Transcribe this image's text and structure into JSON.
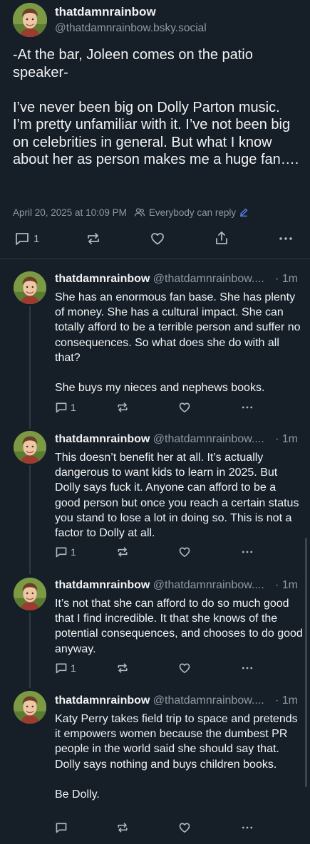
{
  "main_post": {
    "author_name": "thatdamnrainbow",
    "author_handle": "@thatdamnrainbow.bsky.social",
    "text": "-At the bar, Joleen comes on the patio speaker-\n\nI’ve never been big on Dolly Parton music. I’m pretty unfamiliar with it. I’ve not been big on celebrities in general. But what I know about her as person makes me a huge fan….",
    "timestamp": "April 20, 2025 at 10:09 PM",
    "reply_setting": "Everybody can reply",
    "reply_count": "1",
    "icons": [
      "reply-icon",
      "repost-icon",
      "like-icon",
      "share-icon",
      "more-icon",
      "people-icon",
      "pencil-icon"
    ]
  },
  "replies": [
    {
      "author_name": "thatdamnrainbow",
      "author_handle": "@thatdamnrainbow....",
      "time": "· 1m",
      "text": "She has an enormous fan base. She has plenty of money. She has a cultural impact. She can totally afford to be a terrible person and suffer no consequences. So what does she do with all that?\n\nShe buys my nieces and nephews books.",
      "reply_count": "1"
    },
    {
      "author_name": "thatdamnrainbow",
      "author_handle": "@thatdamnrainbow....",
      "time": "· 1m",
      "text": "This doesn’t benefit her at all. It’s actually dangerous to want kids to learn in 2025. But Dolly says fuck it. Anyone can afford to be a good person but once you reach a certain status you stand to lose a lot in doing so. This is not a factor to Dolly at all.",
      "reply_count": "1"
    },
    {
      "author_name": "thatdamnrainbow",
      "author_handle": "@thatdamnrainbow....",
      "time": "· 1m",
      "text": "It’s not that she can afford to do so much good that I find incredible. It that she knows of the potential consequences, and chooses to do good anyway.",
      "reply_count": "1"
    },
    {
      "author_name": "thatdamnrainbow",
      "author_handle": "@thatdamnrainbow....",
      "time": "· 1m",
      "text": "Katy Perry takes field trip to space and pretends it empowers women because the dumbest PR people in the world said she should say that. Dolly says nothing and buys children books.\n\nBe Dolly.",
      "reply_count": ""
    }
  ],
  "colors": {
    "background": "#161e27",
    "text": "#f1f3f5",
    "muted": "#8d99a6",
    "accent_pencil": "#5b8cf0"
  }
}
